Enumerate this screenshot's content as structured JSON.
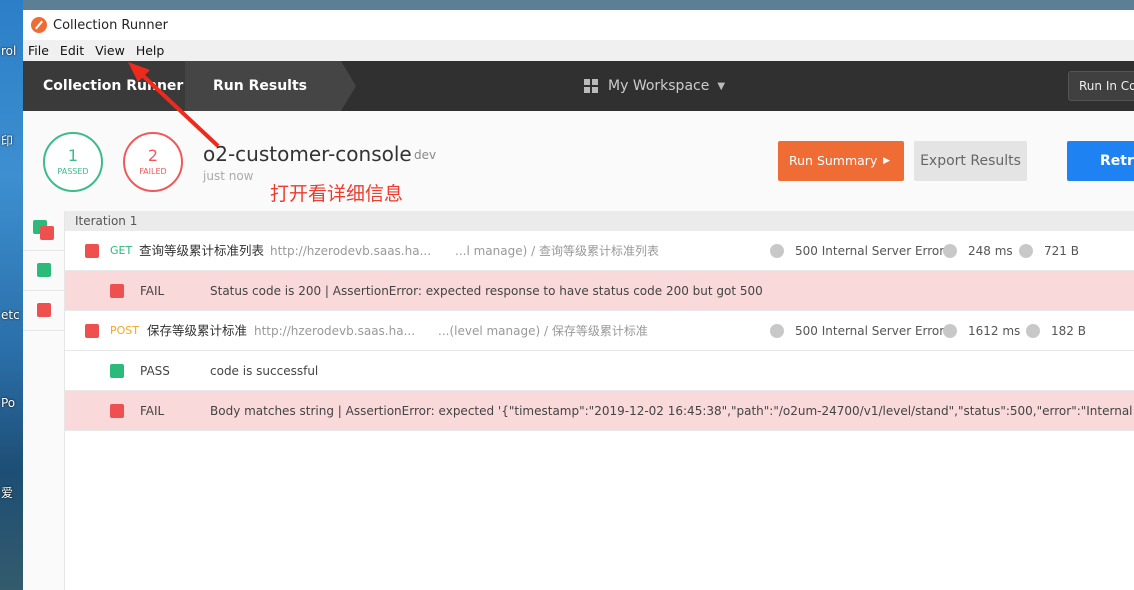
{
  "desktop": {
    "labels": [
      "rol",
      "印",
      "etc",
      "Po",
      "爱"
    ]
  },
  "window": {
    "title": "Collection Runner"
  },
  "menu": [
    "File",
    "Edit",
    "View",
    "Help"
  ],
  "nav": {
    "crumb1": "Collection Runner",
    "crumb2": "Run Results",
    "workspace": "My Workspace",
    "run_in_console": "Run In Console"
  },
  "summary": {
    "passed_count": "1",
    "passed_label": "PASSED",
    "failed_count": "2",
    "failed_label": "FAILED",
    "collection_name": "o2-customer-console",
    "environment": "dev",
    "time": "just now",
    "annotation": "打开看详细信息",
    "run_summary": "Run Summary",
    "export_results": "Export Results",
    "retry": "Retry"
  },
  "results": {
    "iteration": "Iteration 1",
    "requests": [
      {
        "method": "GET",
        "name": "查询等级累计标准列表",
        "url": "http://hzerodevb.saas.ha...",
        "path": "...l manage) / 查询等级累计标准列表",
        "status": "500 Internal Server Error",
        "time": "248 ms",
        "size": "721 B",
        "tests": [
          {
            "result": "FAIL",
            "text": "Status code is 200 | AssertionError: expected response to have status code 200 but got 500"
          }
        ]
      },
      {
        "method": "POST",
        "name": "保存等级累计标准",
        "url": "http://hzerodevb.saas.ha...",
        "path": "...(level manage) / 保存等级累计标准",
        "status": "500 Internal Server Error",
        "time": "1612 ms",
        "size": "182 B",
        "tests": [
          {
            "result": "PASS",
            "text": "code is successful"
          },
          {
            "result": "FAIL",
            "text": "Body matches string | AssertionError: expected '{\"timestamp\":\"2019-12-02 16:45:38\",\"path\":\"/o2um-24700/v1/level/stand\",\"status\":500,\"error\":\"Internal Server Error\","
          }
        ]
      }
    ]
  },
  "colors": {
    "accent": "#ef6c35",
    "pass": "#2cba7a",
    "fail": "#ee4f4f",
    "primary": "#1f82f2"
  }
}
